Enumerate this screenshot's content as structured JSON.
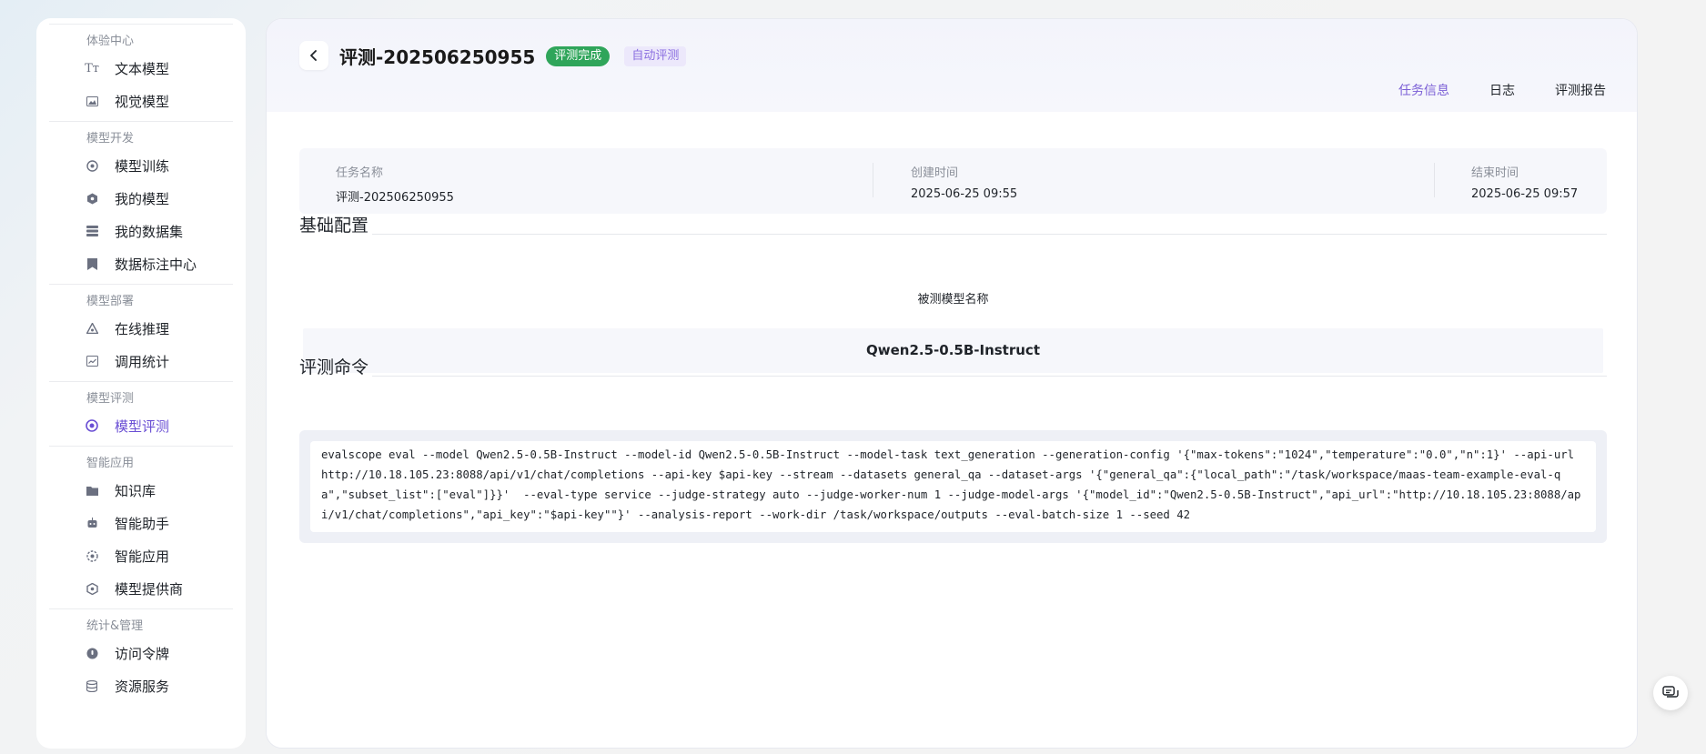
{
  "sidebar": {
    "groups": [
      {
        "title": "体验中心",
        "items": [
          {
            "label": "文本模型",
            "icon": "text-icon"
          },
          {
            "label": "视觉模型",
            "icon": "image-icon"
          }
        ]
      },
      {
        "title": "模型开发",
        "items": [
          {
            "label": "模型训练",
            "icon": "training-icon"
          },
          {
            "label": "我的模型",
            "icon": "model-icon"
          },
          {
            "label": "我的数据集",
            "icon": "dataset-icon"
          },
          {
            "label": "数据标注中心",
            "icon": "bookmark-icon"
          }
        ]
      },
      {
        "title": "模型部署",
        "items": [
          {
            "label": "在线推理",
            "icon": "inference-icon"
          },
          {
            "label": "调用统计",
            "icon": "stats-icon"
          }
        ]
      },
      {
        "title": "模型评测",
        "items": [
          {
            "label": "模型评测",
            "icon": "evaluation-icon",
            "active": true
          }
        ]
      },
      {
        "title": "智能应用",
        "items": [
          {
            "label": "知识库",
            "icon": "folder-icon"
          },
          {
            "label": "智能助手",
            "icon": "robot-icon"
          },
          {
            "label": "智能应用",
            "icon": "app-icon"
          },
          {
            "label": "模型提供商",
            "icon": "provider-icon"
          }
        ]
      },
      {
        "title": "统计&管理",
        "items": [
          {
            "label": "访问令牌",
            "icon": "token-icon"
          },
          {
            "label": "资源服务",
            "icon": "database-icon"
          }
        ]
      }
    ]
  },
  "header": {
    "title": "评测-202506250955",
    "status_badge": "评测完成",
    "type_badge": "自动评测",
    "tabs": [
      {
        "label": "任务信息",
        "active": true
      },
      {
        "label": "日志",
        "active": false
      },
      {
        "label": "评测报告",
        "active": false
      }
    ]
  },
  "info": {
    "task_name_label": "任务名称",
    "task_name": "评测-202506250955",
    "created_label": "创建时间",
    "created": "2025-06-25 09:55",
    "ended_label": "结束时间",
    "ended": "2025-06-25 09:57"
  },
  "basic_config": {
    "section_title": "基础配置",
    "model_name_label": "被测模型名称",
    "model_name": "Qwen2.5-0.5B-Instruct"
  },
  "command": {
    "section_title": "评测命令",
    "text": "evalscope eval --model Qwen2.5-0.5B-Instruct --model-id Qwen2.5-0.5B-Instruct --model-task text_generation --generation-config '{\"max-tokens\":\"1024\",\"temperature\":\"0.0\",\"n\":1}' --api-url http://10.18.105.23:8088/api/v1/chat/completions --api-key $api-key --stream --datasets general_qa --dataset-args '{\"general_qa\":{\"local_path\":\"/task/workspace/maas-team-example-eval-qa\",\"subset_list\":[\"eval\"]}}'  --eval-type service --judge-strategy auto --judge-worker-num 1 --judge-model-args '{\"model_id\":\"Qwen2.5-0.5B-Instruct\",\"api_url\":\"http://10.18.105.23:8088/api/v1/chat/completions\",\"api_key\":\"$api-key\"\"}' --analysis-report --work-dir /task/workspace/outputs --eval-batch-size 1 --seed 42"
  },
  "colors": {
    "accent": "#7b5fd6",
    "success": "#2fa55a"
  }
}
